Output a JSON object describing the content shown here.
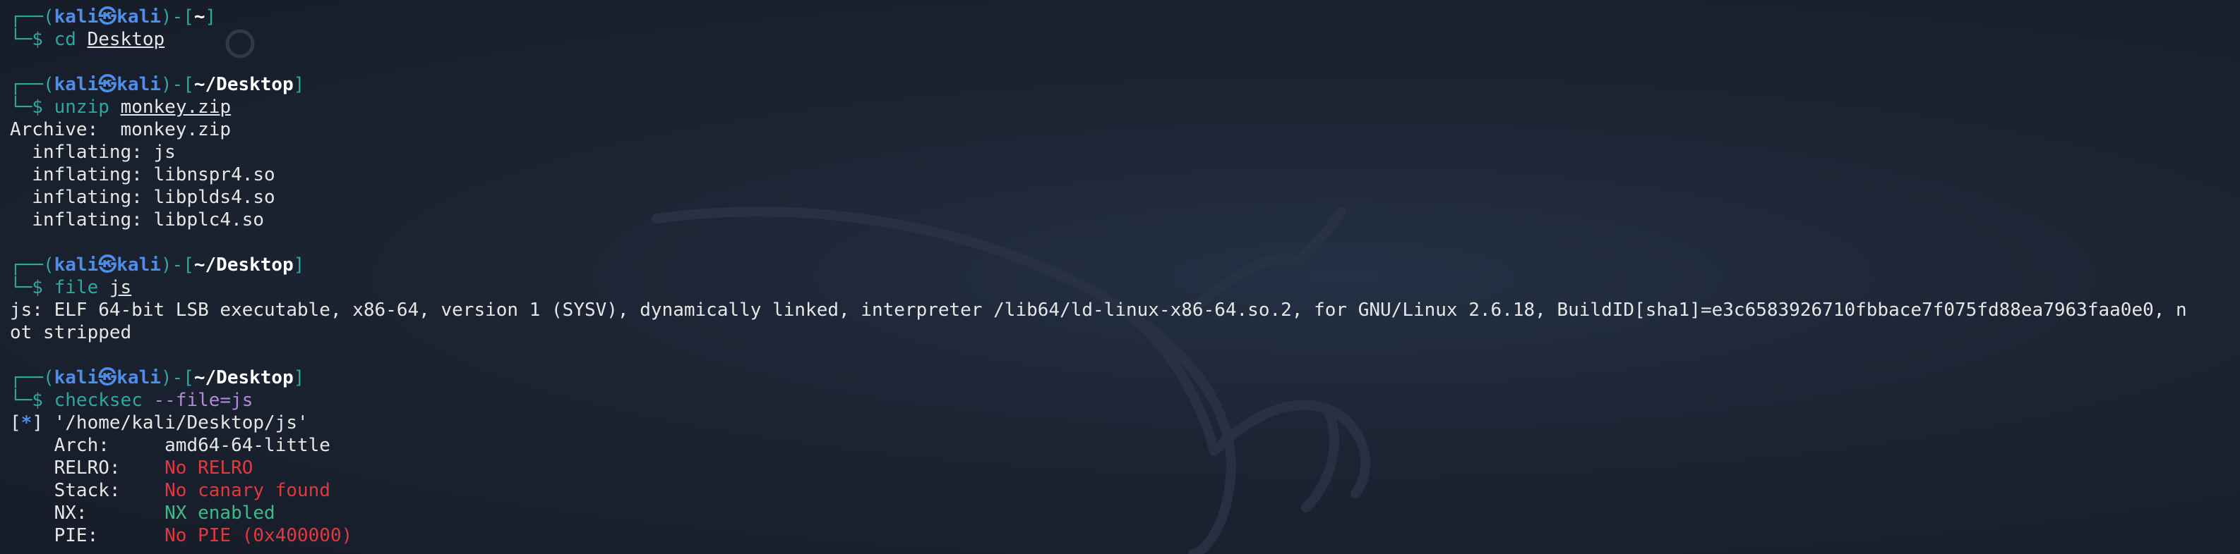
{
  "prompt": {
    "box_top": "┌──(",
    "user": "kali",
    "at": "㉿",
    "host": "kali",
    "close": ")-[",
    "end": "]",
    "box_bottom": "└─$ "
  },
  "blocks": [
    {
      "path": "~",
      "command": "cd",
      "arg": "Desktop",
      "output": []
    },
    {
      "path": "~/Desktop",
      "command": "unzip",
      "arg": "monkey.zip",
      "output": [
        "Archive:  monkey.zip",
        "  inflating: js",
        "  inflating: libnspr4.so",
        "  inflating: libplds4.so",
        "  inflating: libplc4.so"
      ]
    },
    {
      "path": "~/Desktop",
      "command": "file",
      "arg": "js",
      "output": [
        "js: ELF 64-bit LSB executable, x86-64, version 1 (SYSV), dynamically linked, interpreter /lib64/ld-linux-x86-64.so.2, for GNU/Linux 2.6.18, BuildID[sha1]=e3c6583926710fbbace7f075fd88ea7963faa0e0, n",
        "ot stripped"
      ]
    }
  ],
  "checksec": {
    "path": "~/Desktop",
    "command": "checksec",
    "arg": "--file=js",
    "header_open": "[",
    "header_star": "*",
    "header_close": "] '/home/kali/Desktop/js'",
    "rows": [
      {
        "label": "    Arch:     ",
        "value": "amd64-64-little",
        "status": "neutral"
      },
      {
        "label": "    RELRO:    ",
        "value": "No RELRO",
        "status": "bad"
      },
      {
        "label": "    Stack:    ",
        "value": "No canary found",
        "status": "bad"
      },
      {
        "label": "    NX:       ",
        "value": "NX enabled",
        "status": "good"
      },
      {
        "label": "    PIE:      ",
        "value": "No PIE (0x400000)",
        "status": "bad"
      }
    ]
  },
  "colors": {
    "background": "#1b2130",
    "prompt_frame": "#2fa89c",
    "prompt_user": "#4f8de6",
    "bad": "#e0393e",
    "good": "#3fb98a",
    "option": "#b08ad8"
  }
}
